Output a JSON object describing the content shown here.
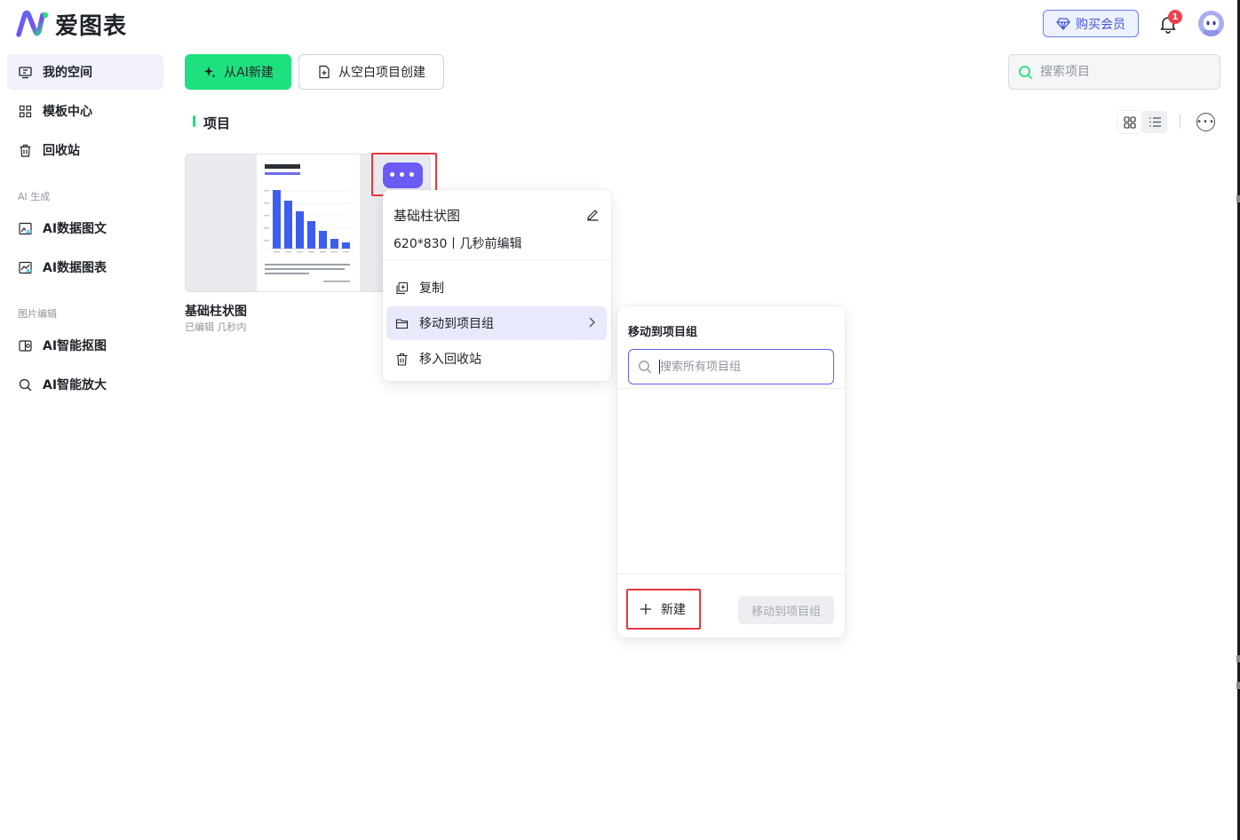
{
  "app": {
    "logo_text": "爱图表",
    "brand_color": "#6c5cf6",
    "accent_green": "#1ee07f"
  },
  "header": {
    "vip_label": "购买会员",
    "notification_count": "1"
  },
  "sidebar": {
    "items": [
      {
        "label": "我的空间",
        "icon": "monitor-icon",
        "active": true
      },
      {
        "label": "模板中心",
        "icon": "grid-icon"
      },
      {
        "label": "回收站",
        "icon": "trash-icon"
      }
    ],
    "group_ai_label": "AI 生成",
    "ai_items": [
      {
        "label": "AI数据图文",
        "icon": "ai-image-text-icon"
      },
      {
        "label": "AI数据图表",
        "icon": "ai-chart-icon"
      }
    ],
    "group_edit_label": "图片编辑",
    "edit_items": [
      {
        "label": "AI智能抠图",
        "icon": "cutout-icon"
      },
      {
        "label": "AI智能放大",
        "icon": "zoom-icon"
      }
    ]
  },
  "toolbar": {
    "new_ai_label": "从AI新建",
    "new_blank_label": "从空白项目创建",
    "search_placeholder": "搜索项目"
  },
  "section": {
    "title": "项目"
  },
  "project": {
    "name": "基础柱状图",
    "meta": "已编辑 几秒内"
  },
  "context_menu": {
    "title": "基础柱状图",
    "subtitle": "620*830丨几秒前编辑",
    "items": [
      {
        "label": "复制",
        "icon": "copy-icon"
      },
      {
        "label": "移动到项目组",
        "icon": "folder-icon",
        "active": true
      },
      {
        "label": "移入回收站",
        "icon": "trash-icon"
      }
    ]
  },
  "move_panel": {
    "title": "移动到项目组",
    "search_placeholder": "搜索所有项目组",
    "new_label": "新建",
    "move_button_label": "移动到项目组"
  }
}
